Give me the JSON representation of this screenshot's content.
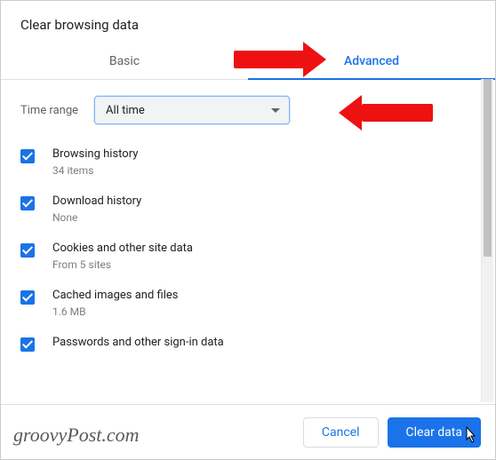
{
  "title": "Clear browsing data",
  "tabs": {
    "basic": "Basic",
    "advanced": "Advanced"
  },
  "time": {
    "label": "Time range",
    "value": "All time"
  },
  "items": [
    {
      "title": "Browsing history",
      "sub": "34 items"
    },
    {
      "title": "Download history",
      "sub": "None"
    },
    {
      "title": "Cookies and other site data",
      "sub": "From 5 sites"
    },
    {
      "title": "Cached images and files",
      "sub": "1.6 MB"
    },
    {
      "title": "Passwords and other sign-in data",
      "sub": ""
    }
  ],
  "buttons": {
    "cancel": "Cancel",
    "clear": "Clear data"
  },
  "watermark": "groovyPost.com"
}
